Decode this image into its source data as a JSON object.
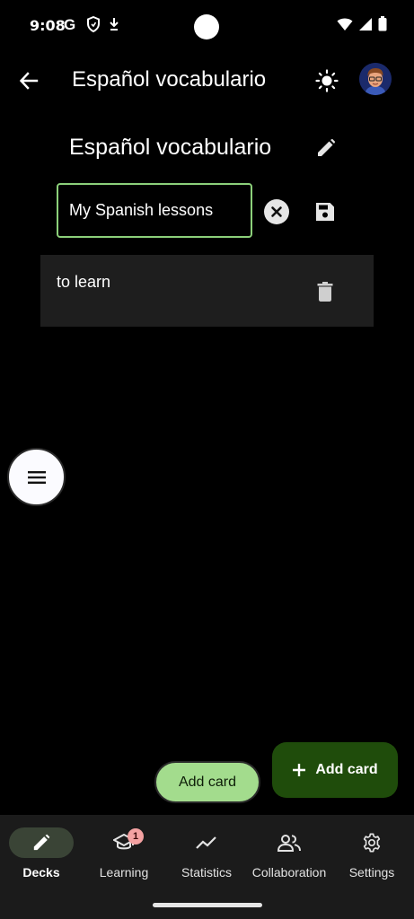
{
  "status_bar": {
    "time": "9:08",
    "icons_left": [
      "google-icon",
      "shield-icon",
      "download-icon"
    ],
    "icons_right": [
      "wifi-icon",
      "signal-icon",
      "battery-icon"
    ]
  },
  "app_bar": {
    "title": "Español vocabulario",
    "back_icon": "arrow-back-icon",
    "theme_icon": "sun-icon"
  },
  "deck": {
    "title": "Español vocabulario",
    "description_value": "My Spanish lessons",
    "description_placeholder": ""
  },
  "cards": [
    {
      "text": "to learn"
    }
  ],
  "buttons": {
    "add_card_small": "Add card",
    "add_card_fab": "Add card"
  },
  "bottom_nav": {
    "items": [
      {
        "label": "Decks",
        "icon": "pencil-icon",
        "active": true
      },
      {
        "label": "Learning",
        "icon": "school-icon",
        "badge": "1"
      },
      {
        "label": "Statistics",
        "icon": "trending-up-icon"
      },
      {
        "label": "Collaboration",
        "icon": "people-icon"
      },
      {
        "label": "Settings",
        "icon": "gear-icon"
      }
    ]
  },
  "colors": {
    "accent_green": "#8cd07a",
    "fab_green": "#1f4c0b",
    "light_green": "#a3dc8d",
    "badge": "#f4a2a2"
  }
}
